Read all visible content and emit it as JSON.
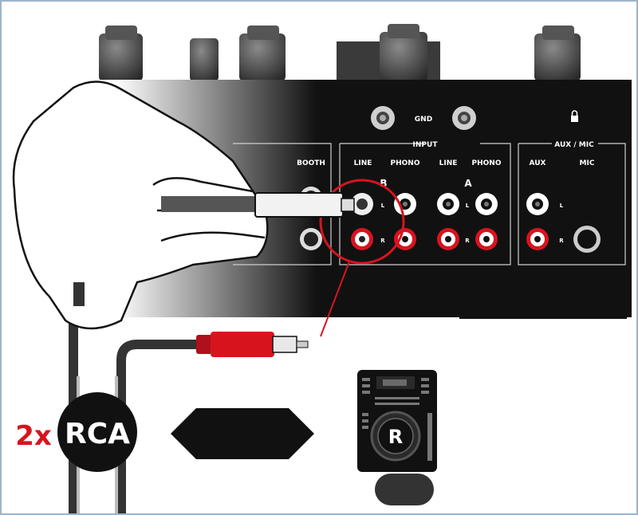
{
  "mixer": {
    "gnd_label": "GND",
    "booth_label": "BOOTH",
    "input_label": "INPUT",
    "line_b_label": "LINE",
    "phono_b_label": "PHONO",
    "line_a_label": "LINE",
    "phono_a_label": "PHONO",
    "channel_b_label": "B",
    "channel_a_label": "A",
    "aux_mic_label": "AUX / MIC",
    "aux_label": "AUX",
    "mic_label": "MIC",
    "left_label": "L",
    "right_label": "R"
  },
  "cable": {
    "count_label": "2x",
    "type_label": "RCA"
  },
  "device": {
    "deck_label": "R"
  },
  "colors": {
    "red": "#d7141e",
    "black": "#111111",
    "outline": "#9db4c8"
  }
}
